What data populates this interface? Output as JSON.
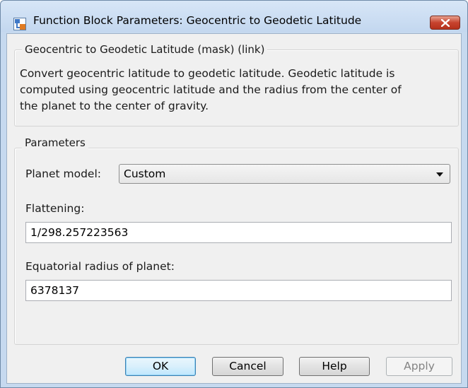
{
  "window": {
    "title": "Function Block Parameters: Geocentric to Geodetic Latitude"
  },
  "description_group": {
    "title": "Geocentric to Geodetic Latitude (mask) (link)",
    "lines": [
      "Convert geocentric latitude to geodetic latitude.  Geodetic latitude is",
      "computed using geocentric latitude and the radius from the center of",
      "the planet to the center of gravity."
    ]
  },
  "parameters_group": {
    "title": "Parameters",
    "planet_model_label": "Planet model:",
    "planet_model_value": "Custom",
    "flattening_label": "Flattening:",
    "flattening_value": "1/298.257223563",
    "radius_label": "Equatorial radius of planet:",
    "radius_value": "6378137"
  },
  "buttons": {
    "ok": "OK",
    "cancel": "Cancel",
    "help": "Help",
    "apply": "Apply"
  },
  "colors": {
    "window_frame": "#c6d9ef",
    "client_background": "#f0f0f0",
    "close_button": "#c7432e"
  }
}
